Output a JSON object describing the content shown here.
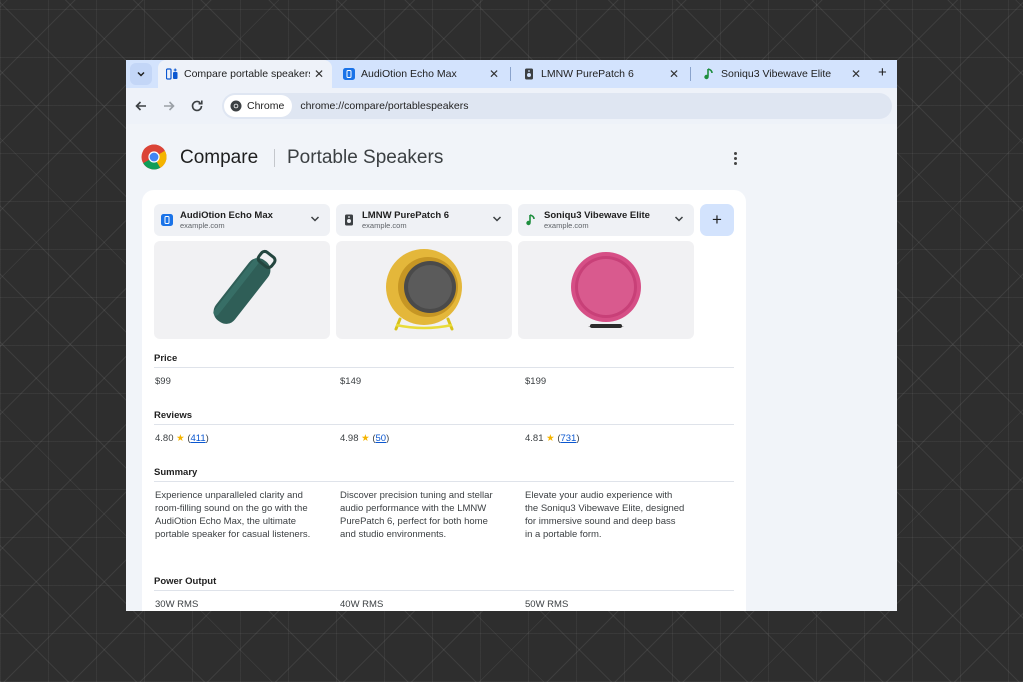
{
  "tabs": [
    {
      "label": "Compare portable speakers",
      "active": true
    },
    {
      "label": "AudiOtion Echo Max"
    },
    {
      "label": "LMNW PurePatch 6"
    },
    {
      "label": "Soniqu3 Vibewave Elite"
    }
  ],
  "toolbar": {
    "chip_label": "Chrome",
    "url": "chrome://compare/portablespeakers"
  },
  "page": {
    "brand": "Compare",
    "title": "Portable Speakers"
  },
  "products": [
    {
      "name": "AudiOtion Echo Max",
      "domain": "example.com",
      "price": "$99",
      "rating": "4.80",
      "reviews": "411",
      "summary": "Experience unparalleled clarity and room-filling sound on the go with the AudiOtion Echo Max, the ultimate portable speaker for casual listeners.",
      "power": "30W RMS",
      "color": "#2f5e57"
    },
    {
      "name": "LMNW PurePatch 6",
      "domain": "example.com",
      "price": "$149",
      "rating": "4.98",
      "reviews": "50",
      "summary": "Discover precision tuning and stellar audio performance with the LMNW PurePatch 6, perfect for both home and studio environments.",
      "power": "40W RMS",
      "color": "#e4b73a"
    },
    {
      "name": "Soniqu3 Vibewave Elite",
      "domain": "example.com",
      "price": "$199",
      "rating": "4.81",
      "reviews": "731",
      "summary": "Elevate your audio experience with the Soniqu3 Vibewave Elite, designed for immersive sound and deep bass in a portable form.",
      "power": "50W RMS",
      "color": "#d64f86"
    }
  ],
  "sections": {
    "price": "Price",
    "reviews": "Reviews",
    "summary": "Summary",
    "power": "Power Output"
  },
  "glyphs": {
    "star": "★",
    "open_paren": "(",
    "close_paren": ")"
  },
  "colors": {
    "tabstrip": "#d3e3fd",
    "accent_blue": "#0b57d0",
    "star": "#f5b400"
  }
}
